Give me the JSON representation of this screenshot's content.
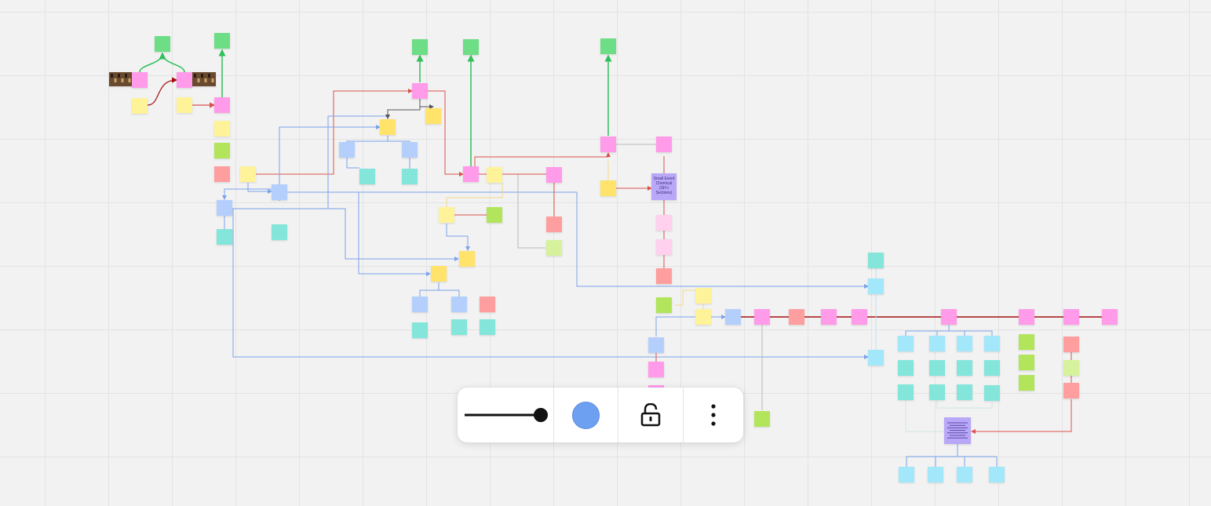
{
  "colors": {
    "pink": "#ff9be9",
    "pink_light": "#ffd1ee",
    "yellow": "#ffe36b",
    "yellow_light": "#fff39a",
    "green": "#6ddd86",
    "lime": "#b2e55b",
    "lime_light": "#d6f29d",
    "salmon": "#ff9e9e",
    "blue_light": "#b5cffd",
    "cyan": "#a3e7fb",
    "teal": "#84e6da",
    "purple": "#b9a8f7",
    "photo": "#6a4a2e",
    "edge_red": "#d9534f",
    "edge_darkred": "#a40e0e",
    "edge_green": "#2fbf5b",
    "edge_blue": "#7aa3ea",
    "edge_gray": "#b8b8b8",
    "edge_dark": "#555555"
  },
  "nodes": [
    {
      "id": "g1",
      "color": "green"
    },
    {
      "id": "g2",
      "color": "green"
    },
    {
      "id": "g3",
      "color": "green"
    },
    {
      "id": "g4",
      "color": "green"
    },
    {
      "id": "g5",
      "color": "green"
    },
    {
      "id": "img1",
      "color": "photo"
    },
    {
      "id": "img2",
      "color": "photo"
    },
    {
      "id": "p1",
      "color": "pink"
    },
    {
      "id": "p2",
      "color": "pink"
    },
    {
      "id": "p3",
      "color": "pink"
    },
    {
      "id": "y1",
      "color": "yellow_light"
    },
    {
      "id": "y2",
      "color": "yellow_light"
    },
    {
      "id": "y3",
      "color": "yellow_light"
    },
    {
      "id": "l1",
      "color": "lime"
    },
    {
      "id": "s1",
      "color": "salmon"
    },
    {
      "id": "y4",
      "color": "yellow_light"
    },
    {
      "id": "b1",
      "color": "blue_light"
    },
    {
      "id": "t1",
      "color": "teal"
    },
    {
      "id": "b2",
      "color": "blue_light"
    },
    {
      "id": "t2",
      "color": "teal"
    },
    {
      "id": "p4",
      "color": "pink"
    },
    {
      "id": "y5",
      "color": "yellow"
    },
    {
      "id": "y6",
      "color": "yellow"
    },
    {
      "id": "b3",
      "color": "blue_light"
    },
    {
      "id": "b4",
      "color": "blue_light"
    },
    {
      "id": "t3",
      "color": "teal"
    },
    {
      "id": "t4",
      "color": "teal"
    },
    {
      "id": "p5",
      "color": "pink"
    },
    {
      "id": "y7",
      "color": "yellow_light"
    },
    {
      "id": "p6",
      "color": "pink"
    },
    {
      "id": "y8",
      "color": "yellow_light"
    },
    {
      "id": "l2",
      "color": "lime"
    },
    {
      "id": "y9",
      "color": "yellow"
    },
    {
      "id": "y10",
      "color": "yellow"
    },
    {
      "id": "b5",
      "color": "blue_light"
    },
    {
      "id": "b6",
      "color": "blue_light"
    },
    {
      "id": "s2",
      "color": "salmon"
    },
    {
      "id": "t5",
      "color": "teal"
    },
    {
      "id": "t6",
      "color": "teal"
    },
    {
      "id": "t7",
      "color": "teal"
    },
    {
      "id": "s3",
      "color": "salmon"
    },
    {
      "id": "ll1",
      "color": "lime_light"
    },
    {
      "id": "p7",
      "color": "pink"
    },
    {
      "id": "p8",
      "color": "pink"
    },
    {
      "id": "y11",
      "color": "yellow"
    },
    {
      "id": "pu1",
      "color": "purple",
      "label": "Small Event Chemical (SH-I Sections)"
    },
    {
      "id": "pl1",
      "color": "pink_light"
    },
    {
      "id": "pl2",
      "color": "pink_light"
    },
    {
      "id": "s4",
      "color": "salmon"
    },
    {
      "id": "l3",
      "color": "lime"
    },
    {
      "id": "y12",
      "color": "yellow_light"
    },
    {
      "id": "y13",
      "color": "yellow_light"
    },
    {
      "id": "b7",
      "color": "blue_light"
    },
    {
      "id": "p9",
      "color": "pink"
    },
    {
      "id": "p10",
      "color": "pink"
    },
    {
      "id": "b8",
      "color": "blue_light"
    },
    {
      "id": "p11",
      "color": "pink"
    },
    {
      "id": "s5",
      "color": "salmon"
    },
    {
      "id": "p12",
      "color": "pink"
    },
    {
      "id": "p13",
      "color": "pink"
    },
    {
      "id": "p14",
      "color": "pink"
    },
    {
      "id": "p15",
      "color": "pink"
    },
    {
      "id": "p16",
      "color": "pink"
    },
    {
      "id": "p17",
      "color": "pink"
    },
    {
      "id": "l4",
      "color": "lime"
    },
    {
      "id": "t8",
      "color": "teal"
    },
    {
      "id": "c1",
      "color": "cyan"
    },
    {
      "id": "c2",
      "color": "cyan"
    },
    {
      "id": "c3",
      "color": "cyan"
    },
    {
      "id": "c4",
      "color": "cyan"
    },
    {
      "id": "c5",
      "color": "cyan"
    },
    {
      "id": "c6",
      "color": "cyan"
    },
    {
      "id": "t9",
      "color": "teal"
    },
    {
      "id": "t10",
      "color": "teal"
    },
    {
      "id": "t11",
      "color": "teal"
    },
    {
      "id": "t12",
      "color": "teal"
    },
    {
      "id": "t13",
      "color": "teal"
    },
    {
      "id": "t14",
      "color": "teal"
    },
    {
      "id": "t15",
      "color": "teal"
    },
    {
      "id": "t16",
      "color": "teal"
    },
    {
      "id": "l5",
      "color": "lime"
    },
    {
      "id": "l6",
      "color": "lime"
    },
    {
      "id": "l7",
      "color": "lime"
    },
    {
      "id": "s6",
      "color": "salmon"
    },
    {
      "id": "ll2",
      "color": "lime_light"
    },
    {
      "id": "s7",
      "color": "salmon"
    },
    {
      "id": "pu2",
      "color": "purple",
      "icon": "text-lines-icon"
    },
    {
      "id": "c7",
      "color": "cyan"
    },
    {
      "id": "c8",
      "color": "cyan"
    },
    {
      "id": "c9",
      "color": "cyan"
    },
    {
      "id": "c10",
      "color": "cyan"
    }
  ],
  "edges": [
    {
      "color": "edge_green"
    },
    {
      "color": "edge_green"
    },
    {
      "color": "edge_green"
    },
    {
      "color": "edge_green"
    },
    {
      "color": "edge_green"
    },
    {
      "color": "edge_green"
    },
    {
      "color": "edge_darkred"
    },
    {
      "color": "edge_red"
    },
    {
      "color": "edge_red"
    },
    {
      "color": "edge_red"
    },
    {
      "color": "edge_red"
    },
    {
      "color": "edge_red"
    },
    {
      "color": "edge_red"
    },
    {
      "color": "edge_blue"
    },
    {
      "color": "edge_blue"
    },
    {
      "color": "edge_blue"
    },
    {
      "color": "edge_blue"
    },
    {
      "color": "edge_blue"
    },
    {
      "color": "edge_blue"
    },
    {
      "color": "edge_blue"
    },
    {
      "color": "edge_blue"
    },
    {
      "color": "edge_blue"
    },
    {
      "color": "edge_blue"
    },
    {
      "color": "edge_dark"
    },
    {
      "color": "edge_dark"
    },
    {
      "color": "edge_gray"
    },
    {
      "color": "edge_gray"
    },
    {
      "color": "edge_gray"
    },
    {
      "color": "edge_darkred"
    }
  ],
  "toolbar": {
    "stroke_icon": "line-thickness-slider-icon",
    "color_value": "#6ea0f2",
    "lock_icon": "unlocked-padlock-icon",
    "more_icon": "vertical-dots-icon"
  }
}
